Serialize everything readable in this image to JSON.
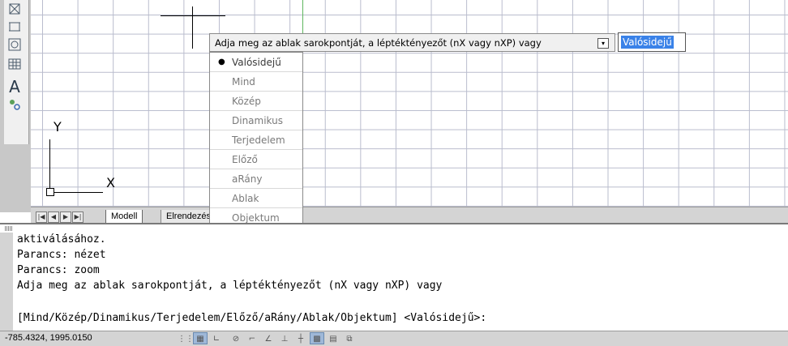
{
  "toolbar": {
    "icons": [
      "block-icon",
      "wblock-icon",
      "revcloud-icon",
      "table-icon",
      "text-icon",
      "attribute-icon"
    ],
    "text_tool_glyph": "A"
  },
  "ucs": {
    "y_label": "Y",
    "x_label": "X"
  },
  "tabs": {
    "nav_buttons": [
      "first",
      "previous",
      "next",
      "last"
    ],
    "items": [
      {
        "label": "Modell",
        "active": true
      },
      {
        "label": "Elrendezés",
        "active": false
      }
    ]
  },
  "dynamic_input": {
    "prompt": "Adja meg az ablak sarokpontját, a léptéktényezőt (nX vagy nXP) vagy",
    "value": "Valósidejű",
    "options": [
      {
        "label": "Valósidejű",
        "selected": true
      },
      {
        "label": "Mind",
        "selected": false
      },
      {
        "label": "Közép",
        "selected": false
      },
      {
        "label": "Dinamikus",
        "selected": false
      },
      {
        "label": "Terjedelem",
        "selected": false
      },
      {
        "label": "Előző",
        "selected": false
      },
      {
        "label": "aRány",
        "selected": false
      },
      {
        "label": "Ablak",
        "selected": false
      },
      {
        "label": "Objektum",
        "selected": false
      }
    ]
  },
  "command_history": [
    "aktiválásához.",
    "Parancs: nézet",
    "Parancs: zoom",
    "Adja meg az ablak sarokpontját, a léptéktényezőt (nX vagy nXP) vagy"
  ],
  "command_prompt": "[Mind/Közép/Dinamikus/Terjedelem/Előző/aRány/Ablak/Objektum] <Valósidejű>:",
  "status": {
    "coordinates": "-785.4324, 1995.0150",
    "buttons": [
      {
        "name": "snap-icon",
        "on": false
      },
      {
        "name": "grid-icon",
        "on": true
      },
      {
        "name": "ortho-icon",
        "on": false
      },
      {
        "name": "polar-icon",
        "on": false
      },
      {
        "name": "osnap-icon",
        "on": false
      },
      {
        "name": "otrack-icon",
        "on": false
      },
      {
        "name": "ducs-icon",
        "on": false
      },
      {
        "name": "dyn-icon",
        "on": false
      },
      {
        "name": "lwt-icon",
        "on": true
      },
      {
        "name": "qp-icon",
        "on": false
      },
      {
        "name": "sc-icon",
        "on": false
      }
    ]
  },
  "colors": {
    "selection": "#3a82e8",
    "grid_line": "#b9bccd",
    "y_axis_line": "#5fb65f"
  }
}
